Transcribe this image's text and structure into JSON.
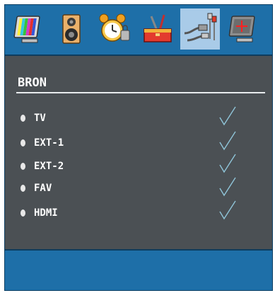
{
  "menu": {
    "tabs": [
      {
        "icon": "picture-icon",
        "active": false
      },
      {
        "icon": "speaker-icon",
        "active": false
      },
      {
        "icon": "alarm-clock-icon",
        "active": false
      },
      {
        "icon": "toolbox-icon",
        "active": false
      },
      {
        "icon": "cables-icon",
        "active": true
      },
      {
        "icon": "monitor-crosshair-icon",
        "active": false
      }
    ]
  },
  "panel": {
    "title": "BRON",
    "sources": [
      {
        "label": "TV",
        "enabled": true
      },
      {
        "label": "EXT-1",
        "enabled": true
      },
      {
        "label": "EXT-2",
        "enabled": true
      },
      {
        "label": "FAV",
        "enabled": true
      },
      {
        "label": "HDMI",
        "enabled": true
      }
    ]
  },
  "colors": {
    "menu_bg": "#1e6fa8",
    "active_tab": "#a9cbe8",
    "panel_bg": "#4b5054",
    "check": "#8fc4d8"
  }
}
